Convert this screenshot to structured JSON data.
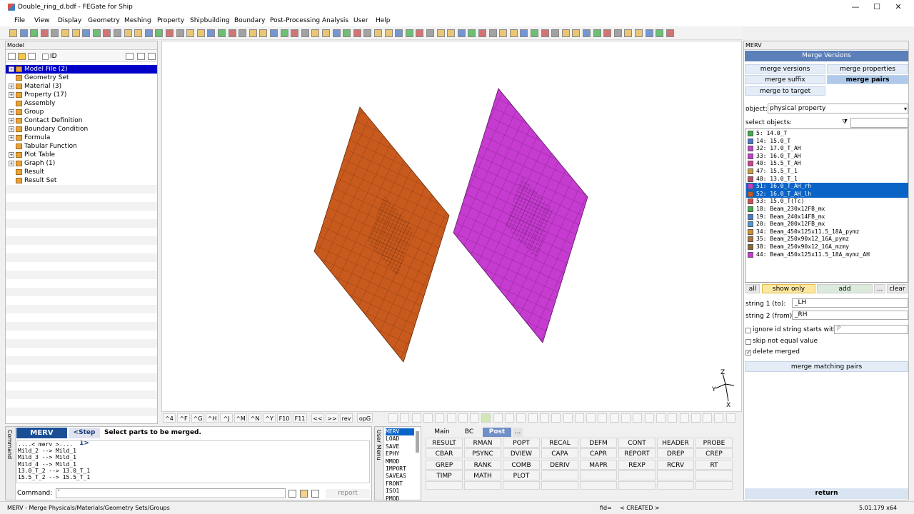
{
  "window": {
    "title": "Double_ring_d.bdf - FEGate for Ship",
    "min": "—",
    "max": "☐",
    "close": "✕"
  },
  "menu": [
    "File",
    "View",
    "Display",
    "Geometry",
    "Meshing",
    "Property",
    "Shipbuilding",
    "Boundary",
    "Post-Processing",
    "Analysis",
    "User",
    "Help"
  ],
  "model": {
    "header": "Model",
    "id_label": "ID",
    "tree": [
      {
        "label": "Model File (2)",
        "expand": "+",
        "selected": true
      },
      {
        "label": "Geometry Set",
        "expand": ""
      },
      {
        "label": "Material (3)",
        "expand": "+"
      },
      {
        "label": "Property (17)",
        "expand": "+"
      },
      {
        "label": "Assembly",
        "expand": ""
      },
      {
        "label": "Group",
        "expand": "+"
      },
      {
        "label": "Contact Definition",
        "expand": "+"
      },
      {
        "label": "Boundary Condition",
        "expand": "+"
      },
      {
        "label": "Formula",
        "expand": "+"
      },
      {
        "label": "Tabular Function",
        "expand": ""
      },
      {
        "label": "Plot Table",
        "expand": "+"
      },
      {
        "label": "Graph (1)",
        "expand": "+"
      },
      {
        "label": "Result",
        "expand": ""
      },
      {
        "label": "Result Set",
        "expand": ""
      }
    ]
  },
  "viewport": {
    "axis_z": "Z",
    "axis_y": "Y",
    "axis_x": "X",
    "plate_colors": {
      "left": "#c85a1e",
      "right": "#c63bd0"
    },
    "toolbar": [
      "^4",
      "^F",
      "^G",
      "^H",
      "^J",
      "^M",
      "^N",
      "^Y",
      "F10",
      "F11",
      "<<",
      ">>",
      "rev",
      "opG"
    ]
  },
  "command": {
    "side_label": "Command",
    "badge": "MERV",
    "step": "<Step 1>",
    "step_text": "Select parts to be merged.",
    "log": [
      "....< merv >....",
      "Mild_2 --> Mild_1",
      "Mild_3 --> Mild_1",
      "Mild_4 --> Mild_1",
      "13.0_T_2 --> 13.0_T_1",
      "15.5_T_2 --> 15.5_T_1"
    ],
    "label": "Command:",
    "value": "'",
    "report": "report"
  },
  "user_menu": {
    "side_label": "User Menu",
    "items": [
      "MERV",
      "LOAD",
      "SAVE",
      "EPHY",
      "MMOD",
      "IMPORT",
      "SAVEAS",
      "FRONT",
      "ISO1",
      "PMOD"
    ]
  },
  "post": {
    "tabs": [
      "Main",
      "BC",
      "Post",
      "..."
    ],
    "buttons": [
      [
        "RESULT",
        "RMAN",
        "POPT",
        "RECAL",
        "DEFM",
        "CONT",
        "HEADER",
        "PROBE"
      ],
      [
        "CBAR",
        "PSYNC",
        "DVIEW",
        "CAPA",
        "CAPR",
        "REPORT",
        "DREP",
        "CREP"
      ],
      [
        "GREP",
        "RANK",
        "COMB",
        "DERIV",
        "MAPR",
        "REXP",
        "RCRV",
        "RT"
      ],
      [
        "TIMP",
        "MATH",
        "PLOT",
        "",
        "",
        "",
        "",
        ""
      ]
    ]
  },
  "merv": {
    "header": "MERV",
    "title": "Merge Versions",
    "buttons": {
      "versions": "merge versions",
      "properties": "merge properties",
      "suffix": "merge suffix",
      "pairs": "merge pairs",
      "target": "merge to target"
    },
    "object_label": "object:",
    "object_value": "physical property",
    "select_label": "select objects:",
    "objects": [
      {
        "text": "5:  14.0_T",
        "color": "#3fae49",
        "selected": false
      },
      {
        "text": "14:  15.0_T",
        "color": "#4a78c9",
        "selected": false
      },
      {
        "text": "32:  17.0_T_AH",
        "color": "#c045c8",
        "selected": false
      },
      {
        "text": "33:  16.0_T_AH",
        "color": "#c63bd0",
        "selected": false
      },
      {
        "text": "40:  15.5_T_AH",
        "color": "#d04090",
        "selected": false
      },
      {
        "text": "47:  15.5_T_1",
        "color": "#c8a040",
        "selected": false
      },
      {
        "text": "48:  13.0_T_1",
        "color": "#c04a6a",
        "selected": false
      },
      {
        "text": "51:  16.0_T_AH_rh",
        "color": "#c63bd0",
        "selected": true
      },
      {
        "text": "52:  16.0_T_AH_lh",
        "color": "#c85a1e",
        "selected": true
      },
      {
        "text": "53:  15.0_T(Tc)",
        "color": "#d05050",
        "selected": false
      },
      {
        "text": "18:  Beam_230x12FB_mx",
        "color": "#3fae49",
        "selected": false
      },
      {
        "text": "19:  Beam_240x14FB_mx",
        "color": "#4a78c9",
        "selected": false
      },
      {
        "text": "20:  Beam_200x12FB_mx",
        "color": "#4a9ad0",
        "selected": false
      },
      {
        "text": "34:  Beam_450x125x11.5_18A_pymz",
        "color": "#d0902e",
        "selected": false
      },
      {
        "text": "35:  Beam_250x90x12_16A_pymz",
        "color": "#b07040",
        "selected": false
      },
      {
        "text": "38:  Beam_250x90x12_16A_mzmy",
        "color": "#8a6a30",
        "selected": false
      },
      {
        "text": "44:  Beam_450x125x11.5_18A_mymz_AH",
        "color": "#c63bd0",
        "selected": false
      }
    ],
    "actions": {
      "all": "all",
      "show_only": "show only",
      "add": "add",
      "more": "...",
      "clear": "clear"
    },
    "string1_label": "string 1 (to):",
    "string1_value": "_LH",
    "string2_label": "string 2 (from):",
    "string2_value": "_RH",
    "ignore_label": "ignore id string starts with:",
    "ignore_value": "P",
    "skip_label": "skip not equal value",
    "delete_label": "delete merged",
    "check_mark": "✓",
    "merge_pairs_btn": "merge matching pairs",
    "return": "return"
  },
  "status": {
    "left": "MERV - Merge Physicals/Materials/Geometry Sets/Groups",
    "fid": "fid=",
    "created": "< CREATED >",
    "version": "5.01.179 x64"
  }
}
